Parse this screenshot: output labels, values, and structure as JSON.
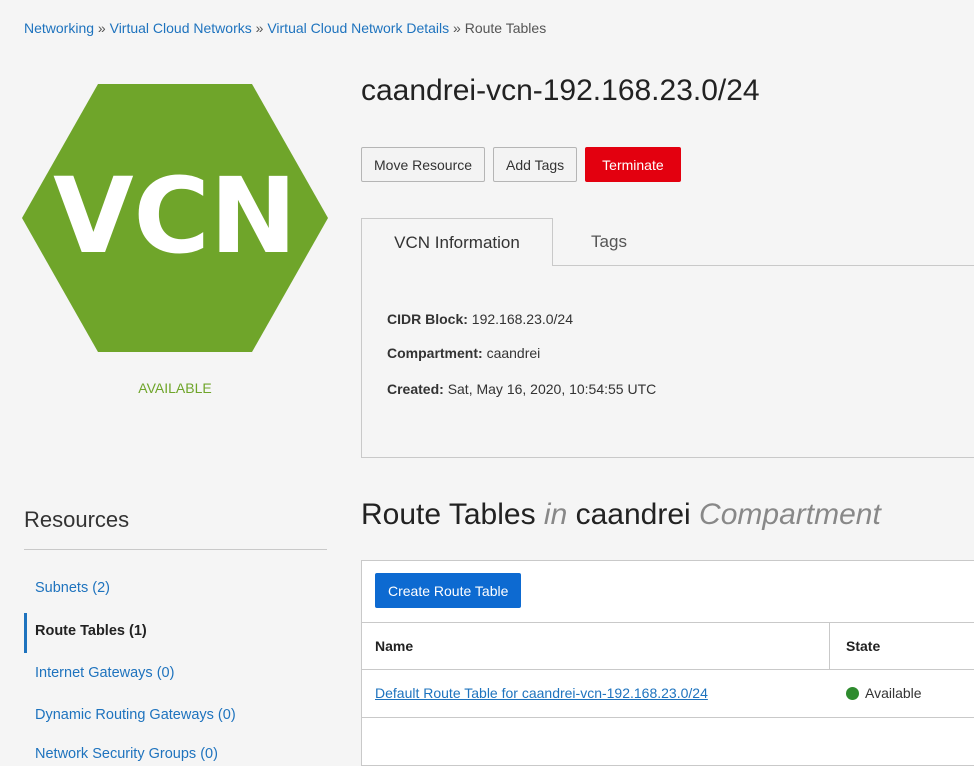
{
  "breadcrumb": {
    "items": [
      "Networking",
      "Virtual Cloud Networks",
      "Virtual Cloud Network Details"
    ],
    "separator": "»",
    "current": "Route Tables"
  },
  "logo": {
    "text": "VCN",
    "color": "#6fa52a"
  },
  "status": {
    "text": "AVAILABLE",
    "color": "#6fa52a"
  },
  "page_title": "caandrei-vcn-192.168.23.0/24",
  "actions": {
    "move": "Move Resource",
    "add_tags": "Add Tags",
    "terminate": "Terminate"
  },
  "tabs": {
    "info": "VCN Information",
    "tags": "Tags"
  },
  "info": {
    "cidr_label": "CIDR Block:",
    "cidr_value": "192.168.23.0/24",
    "compartment_label": "Compartment:",
    "compartment_value": "caandrei",
    "created_label": "Created:",
    "created_value": "Sat, May 16, 2020, 10:54:55 UTC"
  },
  "resources": {
    "title": "Resources",
    "items": [
      {
        "label": "Subnets (2)"
      },
      {
        "label": "Route Tables (1)"
      },
      {
        "label": "Internet Gateways (0)"
      },
      {
        "label": "Dynamic Routing Gateways (0)"
      },
      {
        "label": "Network Security Groups (0)"
      }
    ]
  },
  "section": {
    "title_main": "Route Tables",
    "title_in": "in",
    "compartment": "caandrei",
    "title_suffix": "Compartment"
  },
  "table": {
    "create_button": "Create Route Table",
    "columns": [
      "Name",
      "State"
    ],
    "rows": [
      {
        "name": "Default Route Table for caandrei-vcn-192.168.23.0/24",
        "state": "Available",
        "state_color": "#2e8b2e"
      }
    ]
  },
  "colors": {
    "link": "#1e73be",
    "danger": "#e3000f",
    "primary": "#0d6ad1"
  }
}
